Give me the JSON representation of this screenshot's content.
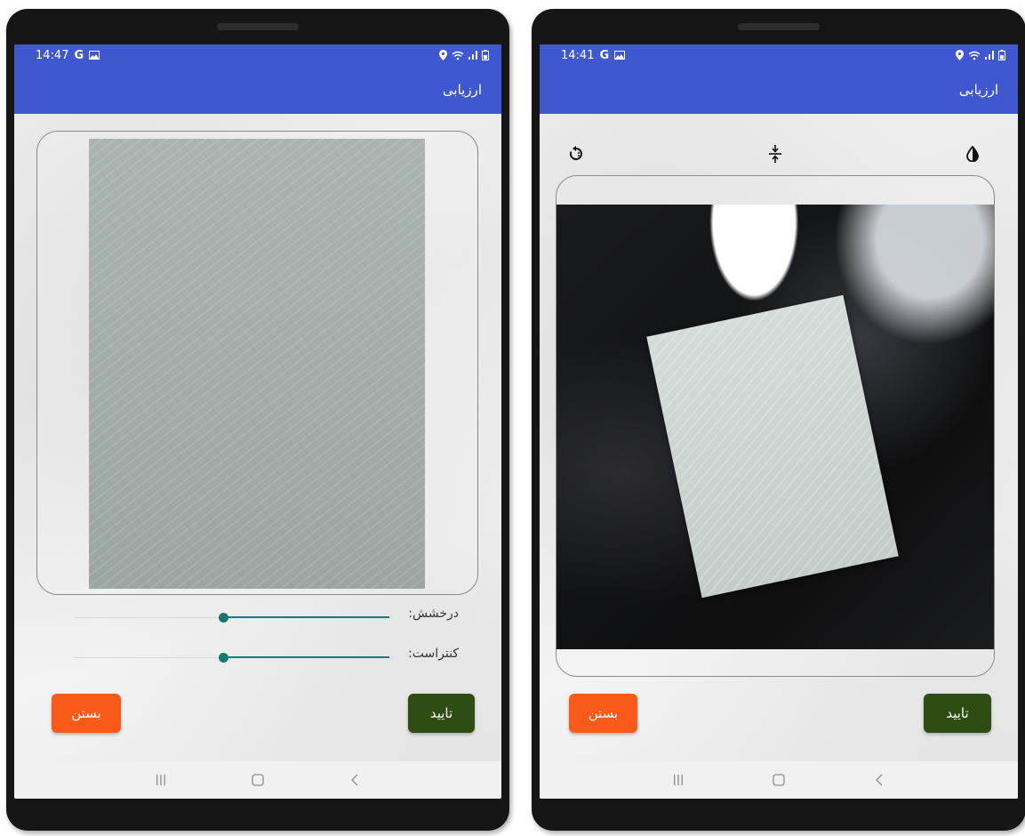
{
  "left_screen": {
    "status": {
      "time": "14:47",
      "google_glyph": "G"
    },
    "app_bar": {
      "title": "ارزیابی"
    },
    "sliders": [
      {
        "label": "درخشش:",
        "value_fraction": 0.5
      },
      {
        "label": "کنتراست:",
        "value_fraction": 0.5
      }
    ],
    "buttons": {
      "confirm": "تایید",
      "close": "بستن"
    }
  },
  "right_screen": {
    "status": {
      "time": "14:41",
      "google_glyph": "G"
    },
    "app_bar": {
      "title": "ارزیابی"
    },
    "toolbar_icons": [
      "rotate-icon",
      "compress-icon",
      "contrast-icon"
    ],
    "buttons": {
      "confirm": "تایید",
      "close": "بستن"
    }
  },
  "colors": {
    "app_bar": "#3f58cf",
    "confirm_button": "#2e4d13",
    "close_button": "#fa5a19",
    "slider_accent": "#157a73"
  },
  "icons": {
    "status": [
      "image-icon",
      "location-icon",
      "wifi-icon",
      "signal-icon",
      "battery-icon"
    ],
    "navigation": [
      "recent-apps-icon",
      "home-icon",
      "back-icon"
    ]
  }
}
